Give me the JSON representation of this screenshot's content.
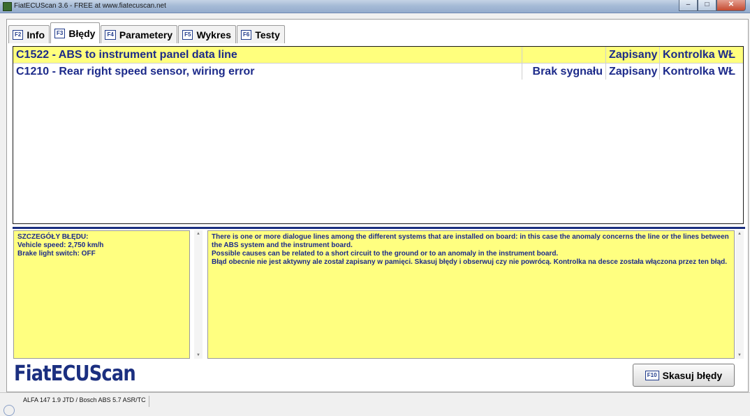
{
  "window": {
    "title": "FiatECUScan 3.6 - FREE at www.fiatecuscan.net",
    "minimize": "–",
    "maximize": "□",
    "close": "✕"
  },
  "tabs": [
    {
      "key": "F2",
      "label": "Info"
    },
    {
      "key": "F3",
      "label": "Błędy"
    },
    {
      "key": "F4",
      "label": "Parametery"
    },
    {
      "key": "F5",
      "label": "Wykres"
    },
    {
      "key": "F6",
      "label": "Testy"
    }
  ],
  "errors": [
    {
      "description": "C1522 - ABS to instrument panel data line",
      "signal": "",
      "status": "Zapisany",
      "lamp": "Kontrolka WŁ"
    },
    {
      "description": "C1210 - Rear right speed sensor, wiring error",
      "signal": "Brak sygnału",
      "status": "Zapisany",
      "lamp": "Kontrolka WŁ"
    }
  ],
  "details": {
    "heading": "SZCZEGÓŁY BŁĘDU:",
    "lines": [
      "Vehicle speed: 2,750 km/h",
      "Brake light switch: OFF"
    ]
  },
  "info_text": [
    "There is one or more dialogue lines among the different systems that are installed on board: in this case the anomaly concerns the line or the lines between the ABS system and the instrument board.",
    "Possible causes can be related to a short circuit to the ground or to an anomaly in the instrument board.",
    "Błąd obecnie nie jest aktywny ale został zapisany w pamięci. Skasuj błędy i obserwuj czy nie powrócą. Kontrolka na desce została włączona przez ten błąd."
  ],
  "logo": "FiatECUScan",
  "clear_button": {
    "key": "F10",
    "label": "Skasuj błędy"
  },
  "status_bar": {
    "vehicle": "ALFA 147 1.9 JTD / Bosch ABS 5.7 ASR/TC"
  },
  "colors": {
    "accent_blue": "#1b2f80",
    "highlight_yellow": "#ffff80",
    "error_row": "#ffff7d"
  }
}
